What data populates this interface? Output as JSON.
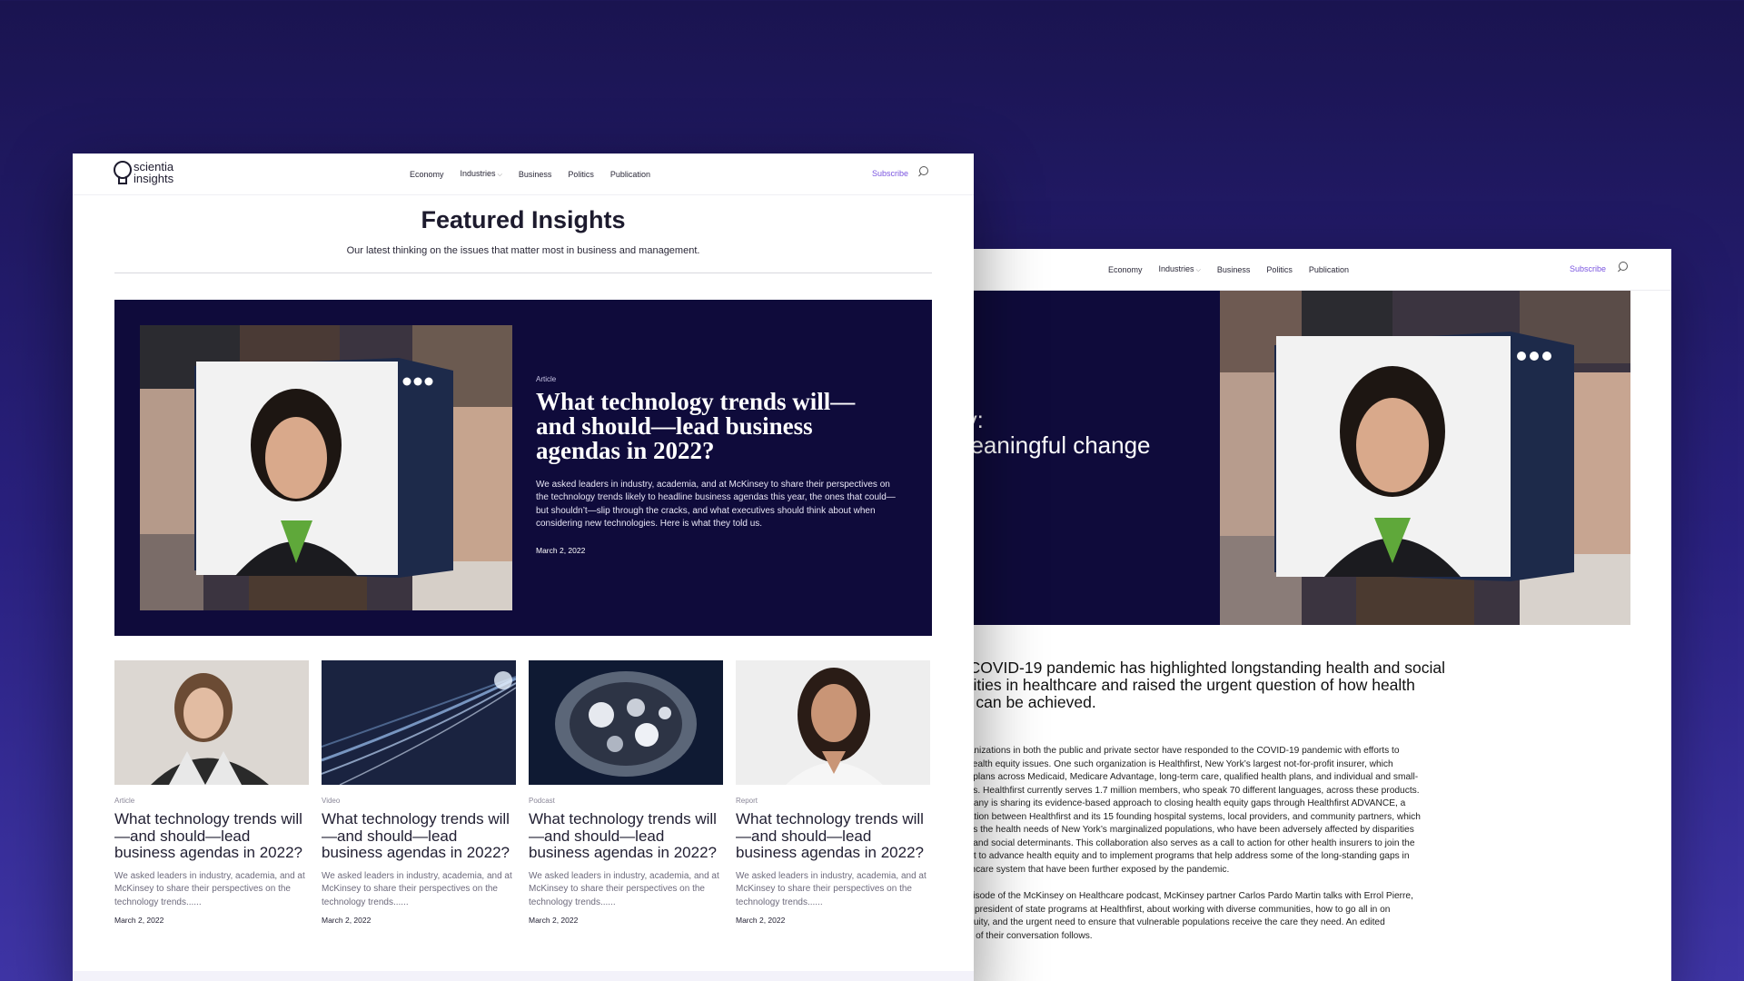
{
  "colors": {
    "accent": "#7b55e0",
    "hero_bg": "#0f0b3b",
    "page_bg": "#2a2180"
  },
  "front": {
    "logo": {
      "line1": "scientia",
      "line2": "insights",
      "icon": "lightbulb-logo-icon"
    },
    "nav": {
      "items": [
        "Economy",
        "Industries",
        "Business",
        "Politics",
        "Publication"
      ],
      "subscribe": "Subscribe",
      "search_icon": "search-icon"
    },
    "page_title": "Featured Insights",
    "page_subtitle": "Our latest thinking on the issues that matter most in business and management.",
    "feature": {
      "type": "Article",
      "title": "What technology trends will—and should—lead business agendas in 2022?",
      "excerpt": "We asked leaders in industry, academia, and at McKinsey to share their perspectives on the technology trends likely to headline business agendas this year, the ones that could—but shouldn’t—slip through the cracks, and what executives should think about when considering new technologies. Here is what they told us.",
      "date": "March 2, 2022"
    },
    "cards": [
      {
        "type": "Article",
        "title": "What technology trends will—and should—lead business agendas in 2022?",
        "excerpt": "We asked leaders in industry, academia, and at McKinsey to share their perspectives on the technology trends......",
        "date": "March 2, 2022"
      },
      {
        "type": "Video",
        "title": "What technology trends will—and should—lead business agendas in 2022?",
        "excerpt": "We asked leaders in industry, academia, and at McKinsey to share their perspectives on the technology trends......",
        "date": "March 2, 2022"
      },
      {
        "type": "Podcast",
        "title": "What technology trends will—and should—lead business agendas in 2022?",
        "excerpt": "We asked leaders in industry, academia, and at McKinsey to share their perspectives on the technology trends......",
        "date": "March 2, 2022"
      },
      {
        "type": "Report",
        "title": "What technology trends will—and should—lead business agendas in 2022?",
        "excerpt": "We asked leaders in industry, academia, and at McKinsey to share their perspectives on the technology trends......",
        "date": "March 2, 2022"
      }
    ]
  },
  "back": {
    "nav": {
      "items": [
        "Economy",
        "Industries",
        "Business",
        "Politics",
        "Publication"
      ],
      "subscribe": "Subscribe"
    },
    "hero_title_line1": "ry:",
    "hero_title_line2": "neaningful change",
    "article_heading_lines": [
      "e COVID-19 pandemic has highlighted longstanding health and social",
      "quities in healthcare and raised the urgent question of how health",
      "ity can be achieved."
    ],
    "paragraph1_lines": [
      "organizations in both the public and private sector have responded to the COVID-19 pandemic with efforts to",
      "ss health equity issues. One such organization is Healthfirst, New York’s largest not-for-profit insurer, which",
      "des plans across Medicaid, Medicare Advantage, long-term care, qualified health plans, and individual and small-",
      "plans. Healthfirst currently serves 1.7 million members, who speak 70 different languages, across these products.",
      "ompany is sharing its evidence-based approach to closing health equity gaps through Healthfirst ADVANCE, a",
      "boration between Healthfirst and its 15 founding hospital systems, local providers, and community partners, which",
      "pions the health needs of New York’s marginalized populations, who have been adversely affected by disparities",
      "alth and social determinants. This collaboration also serves as a call to action for other health insurers to join the",
      "ment to advance health equity and to implement programs that help address some of the long-standing gaps in",
      "ealthcare system that have been further exposed by the pandemic."
    ],
    "paragraph2_lines": [
      "s episode of the McKinsey on Healthcare podcast, McKinsey partner Carlos Pardo Martin talks with Errol Pierre,",
      "vice president of state programs at Healthfirst, about working with diverse communities, how to go all in on",
      "n equity, and the urgent need to ensure that vulnerable populations receive the care they need. An edited",
      "cript of their conversation follows."
    ]
  }
}
